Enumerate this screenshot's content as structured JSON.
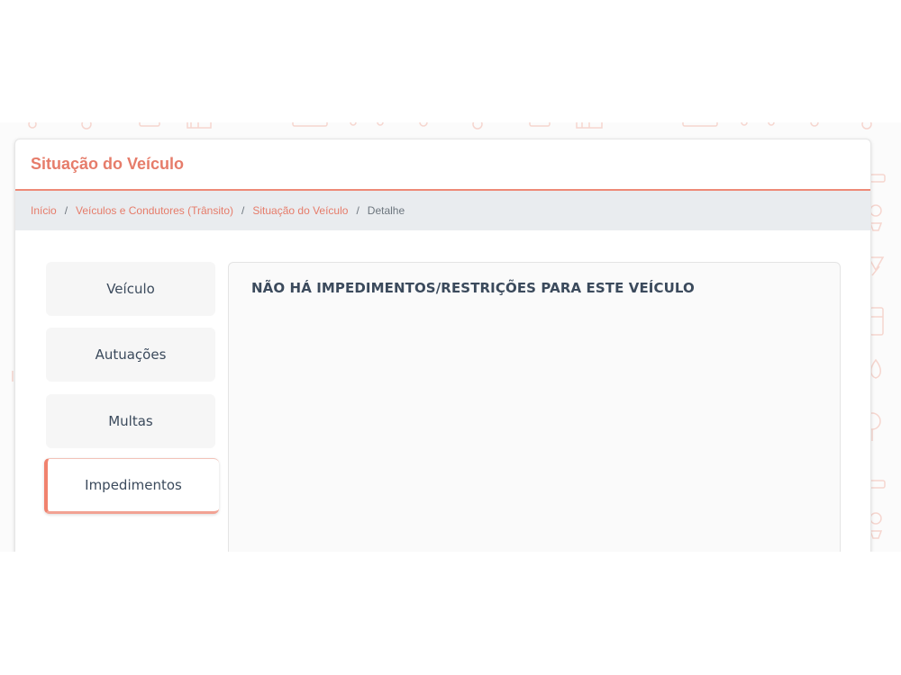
{
  "page": {
    "title": "Situação do Veículo"
  },
  "breadcrumb": {
    "items": [
      {
        "label": "Início",
        "link": true
      },
      {
        "label": "Veículos e Condutores (Trânsito)",
        "link": true
      },
      {
        "label": "Situação do Veículo",
        "link": true
      },
      {
        "label": "Detalhe",
        "link": false
      }
    ],
    "separator": "/"
  },
  "tabs": [
    {
      "label": "Veículo",
      "active": false
    },
    {
      "label": "Autuações",
      "active": false
    },
    {
      "label": "Multas",
      "active": false
    },
    {
      "label": "Impedimentos",
      "active": true
    }
  ],
  "content": {
    "message": "NÃO HÁ IMPEDIMENTOS/RESTRIÇÕES PARA ESTE VEÍCULO"
  },
  "colors": {
    "accent": "#e67c6a",
    "breadcrumb_bg": "#e9ecef",
    "text": "#3b4a5c"
  }
}
